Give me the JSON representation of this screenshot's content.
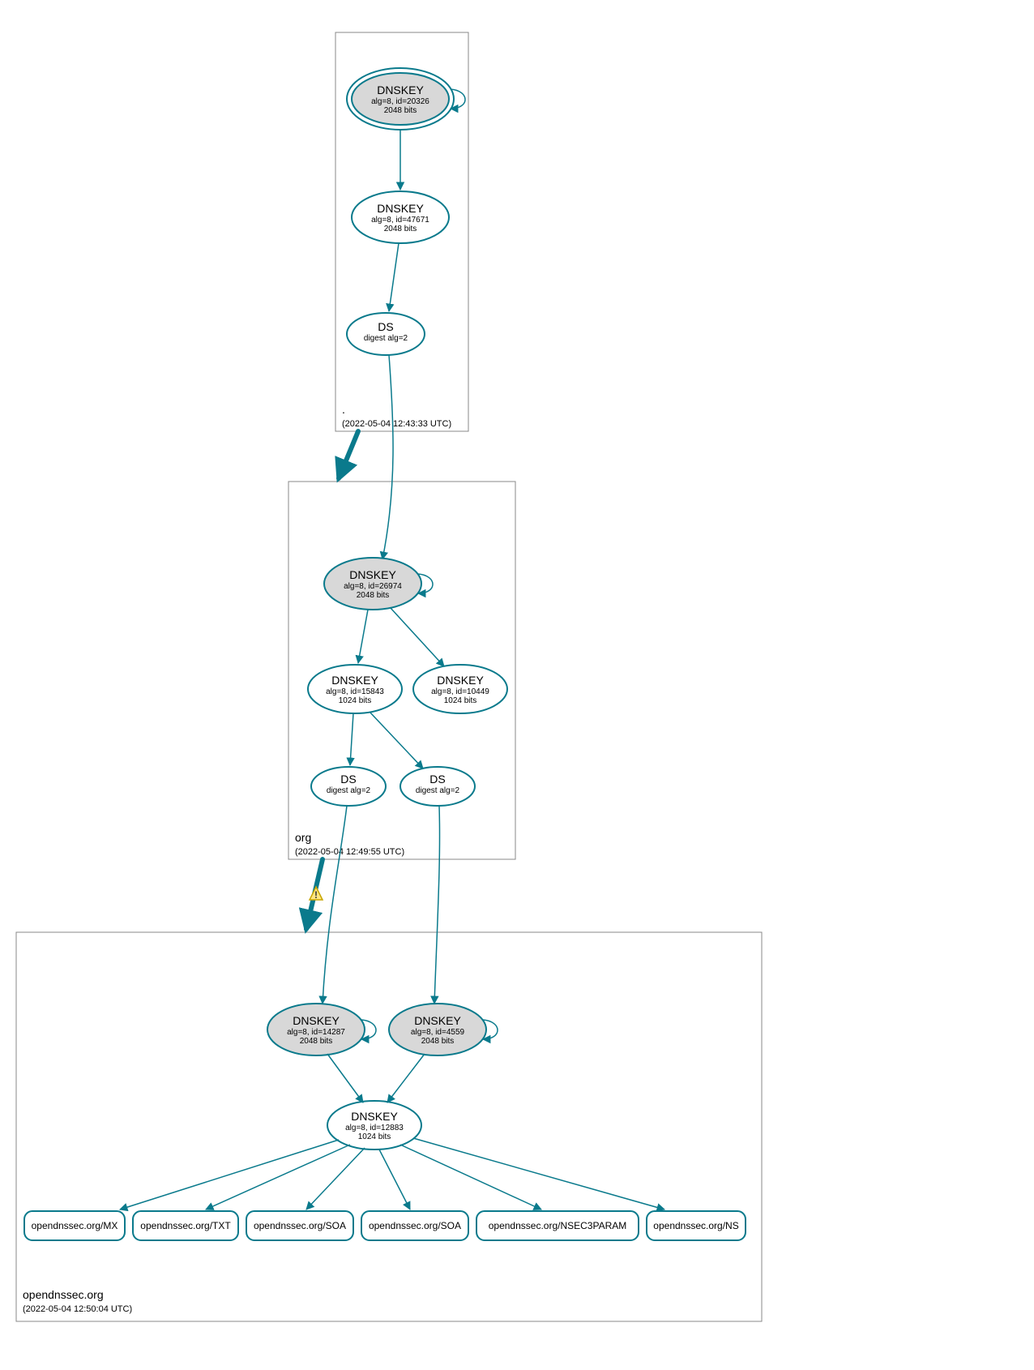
{
  "zones": {
    "root": {
      "label": ".",
      "timestamp": "(2022-05-04 12:43:33 UTC)"
    },
    "org": {
      "label": "org",
      "timestamp": "(2022-05-04 12:49:55 UTC)"
    },
    "opendnssec": {
      "label": "opendnssec.org",
      "timestamp": "(2022-05-04 12:50:04 UTC)"
    }
  },
  "nodes": {
    "root_ksk": {
      "title": "DNSKEY",
      "line2": "alg=8, id=20326",
      "line3": "2048 bits"
    },
    "root_zsk": {
      "title": "DNSKEY",
      "line2": "alg=8, id=47671",
      "line3": "2048 bits"
    },
    "root_ds": {
      "title": "DS",
      "line2": "digest alg=2"
    },
    "org_ksk": {
      "title": "DNSKEY",
      "line2": "alg=8, id=26974",
      "line3": "2048 bits"
    },
    "org_zsk1": {
      "title": "DNSKEY",
      "line2": "alg=8, id=15843",
      "line3": "1024 bits"
    },
    "org_zsk2": {
      "title": "DNSKEY",
      "line2": "alg=8, id=10449",
      "line3": "1024 bits"
    },
    "org_ds1": {
      "title": "DS",
      "line2": "digest alg=2"
    },
    "org_ds2": {
      "title": "DS",
      "line2": "digest alg=2"
    },
    "od_ksk1": {
      "title": "DNSKEY",
      "line2": "alg=8, id=14287",
      "line3": "2048 bits"
    },
    "od_ksk2": {
      "title": "DNSKEY",
      "line2": "alg=8, id=4559",
      "line3": "2048 bits"
    },
    "od_zsk": {
      "title": "DNSKEY",
      "line2": "alg=8, id=12883",
      "line3": "1024 bits"
    }
  },
  "records": {
    "mx": "opendnssec.org/MX",
    "txt": "opendnssec.org/TXT",
    "soa1": "opendnssec.org/SOA",
    "soa2": "opendnssec.org/SOA",
    "n3p": "opendnssec.org/NSEC3PARAM",
    "ns": "opendnssec.org/NS"
  }
}
